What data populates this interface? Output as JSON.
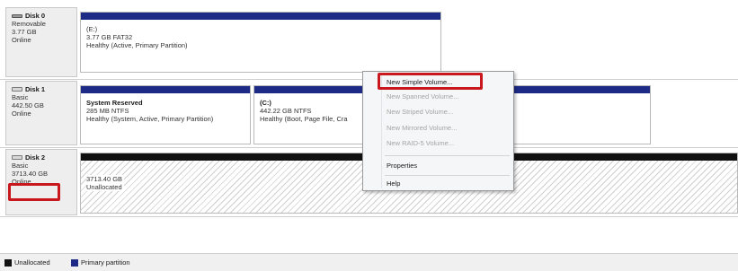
{
  "disks": [
    {
      "name": "Disk 0",
      "type": "Removable",
      "size": "3.77 GB",
      "status": "Online",
      "volumes": [
        {
          "name": "(E:)",
          "size_fs": "3.77 GB FAT32",
          "status": "Healthy (Active, Primary Partition)"
        }
      ]
    },
    {
      "name": "Disk 1",
      "type": "Basic",
      "size": "442.50 GB",
      "status": "Online",
      "volumes": [
        {
          "name": "System Reserved",
          "size_fs": "285 MB NTFS",
          "status": "Healthy (System, Active, Primary Partition)"
        },
        {
          "name": "(C:)",
          "size_fs": "442.22 GB NTFS",
          "status": "Healthy (Boot, Page File, Cra"
        }
      ]
    },
    {
      "name": "Disk 2",
      "type": "Basic",
      "size": "3713.40 GB",
      "status": "Online",
      "volumes": [
        {
          "size": "3713.40 GB",
          "status": "Unallocated"
        }
      ]
    }
  ],
  "context_menu": {
    "items": [
      {
        "label": "New Simple Volume...",
        "enabled": true
      },
      {
        "label": "New Spanned Volume...",
        "enabled": false
      },
      {
        "label": "New Striped Volume...",
        "enabled": false
      },
      {
        "label": "New Mirrored Volume...",
        "enabled": false
      },
      {
        "label": "New RAID-5 Volume...",
        "enabled": false
      },
      {
        "label": "Properties",
        "enabled": true
      },
      {
        "label": "Help",
        "enabled": true
      }
    ]
  },
  "legend": [
    {
      "label": "Unallocated",
      "color": "#111111"
    },
    {
      "label": "Primary partition",
      "color": "#1e2b86"
    }
  ],
  "colors": {
    "primary_partition": "#1e2b86",
    "unallocated": "#111111",
    "highlight": "#c8181e"
  },
  "icons": {
    "removable_disk": "removable-disk-icon",
    "basic_disk": "basic-disk-icon"
  }
}
